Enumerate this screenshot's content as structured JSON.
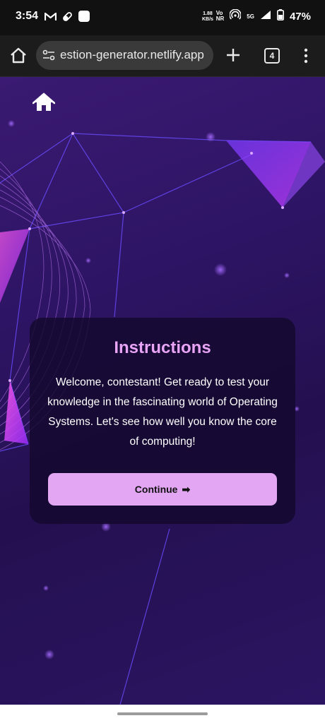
{
  "status_bar": {
    "time": "3:54",
    "net_speed_value": "1.88",
    "net_speed_unit": "KB/s",
    "volte_top": "Vo",
    "volte_bottom": "NR",
    "network": "5G",
    "battery": "47%"
  },
  "browser": {
    "url": "estion-generator.netlify.app",
    "tab_count": "4"
  },
  "card": {
    "title": "Instructions",
    "body": "Welcome, contestant! Get ready to test your knowledge in the fascinating world of Operating Systems. Let's see how well you know the core of computing!",
    "button_label": "Continue",
    "button_arrow": "➡"
  },
  "colors": {
    "accent": "#e9a4f5",
    "button_bg": "#e2a6f3",
    "background_deep": "#241050"
  }
}
